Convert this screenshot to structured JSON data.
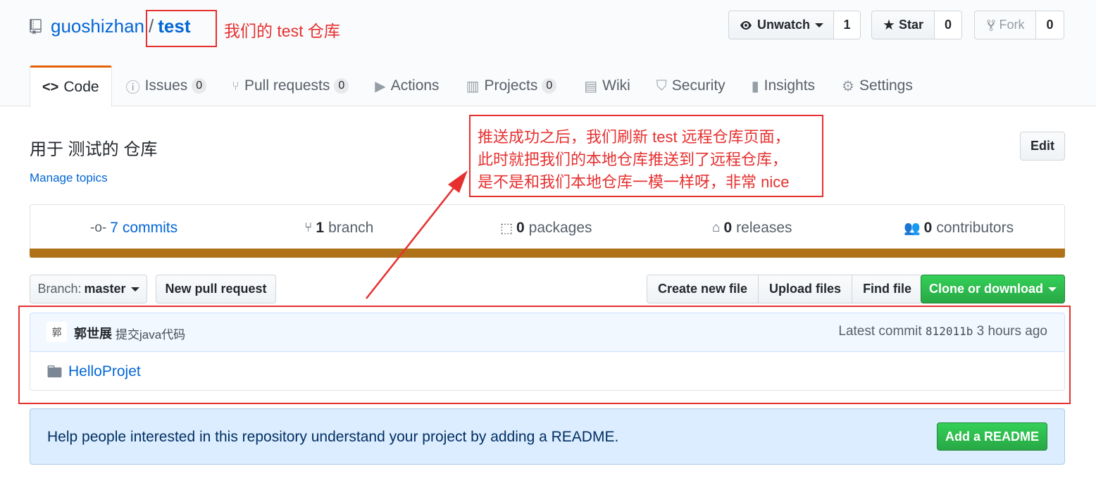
{
  "repo": {
    "owner": "guoshizhan",
    "separator": "/",
    "name": "test"
  },
  "actions": {
    "watch": {
      "label": "Unwatch",
      "count": "1"
    },
    "star": {
      "label": "Star",
      "count": "0"
    },
    "fork": {
      "label": "Fork",
      "count": "0"
    }
  },
  "tabs": [
    {
      "label": "Code",
      "icon": "code-icon",
      "selected": true
    },
    {
      "label": "Issues",
      "icon": "issue-icon",
      "count": "0"
    },
    {
      "label": "Pull requests",
      "icon": "pull-request-icon",
      "count": "0"
    },
    {
      "label": "Actions",
      "icon": "play-icon"
    },
    {
      "label": "Projects",
      "icon": "project-icon",
      "count": "0"
    },
    {
      "label": "Wiki",
      "icon": "book-icon"
    },
    {
      "label": "Security",
      "icon": "shield-icon"
    },
    {
      "label": "Insights",
      "icon": "graph-icon"
    },
    {
      "label": "Settings",
      "icon": "gear-icon"
    }
  ],
  "description": "用于 测试的 仓库",
  "manage_topics": "Manage topics",
  "edit_label": "Edit",
  "summary": {
    "commits": {
      "num": "7",
      "label": "commits"
    },
    "branches": {
      "num": "1",
      "label": "branch"
    },
    "packages": {
      "num": "0",
      "label": "packages"
    },
    "releases": {
      "num": "0",
      "label": "releases"
    },
    "contributors": {
      "num": "0",
      "label": "contributors"
    },
    "language_color": "#b07219"
  },
  "file_nav": {
    "branch_prefix": "Branch:",
    "branch_name": "master",
    "new_pull_request": "New pull request",
    "create_new_file": "Create new file",
    "upload_files": "Upload files",
    "find_file": "Find file",
    "clone_or_download": "Clone or download"
  },
  "commit": {
    "avatar_text": "郭",
    "author": "郭世展",
    "message": "提交java代码",
    "latest_label": "Latest commit",
    "sha": "812011b",
    "time": "3 hours ago"
  },
  "files": [
    {
      "name": "HelloProjet",
      "type": "folder"
    }
  ],
  "readme": {
    "text": "Help people interested in this repository understand your project by adding a README.",
    "button": "Add a README"
  },
  "annotations": {
    "repo_note": "我们的 test 仓库",
    "callout_lines": [
      "推送成功之后，我们刷新 test 远程仓库页面，",
      "此时就把我们的本地仓库推送到了远程仓库，",
      "是不是和我们本地仓库一模一样呀，非常 nice"
    ],
    "color": "#e63030"
  }
}
